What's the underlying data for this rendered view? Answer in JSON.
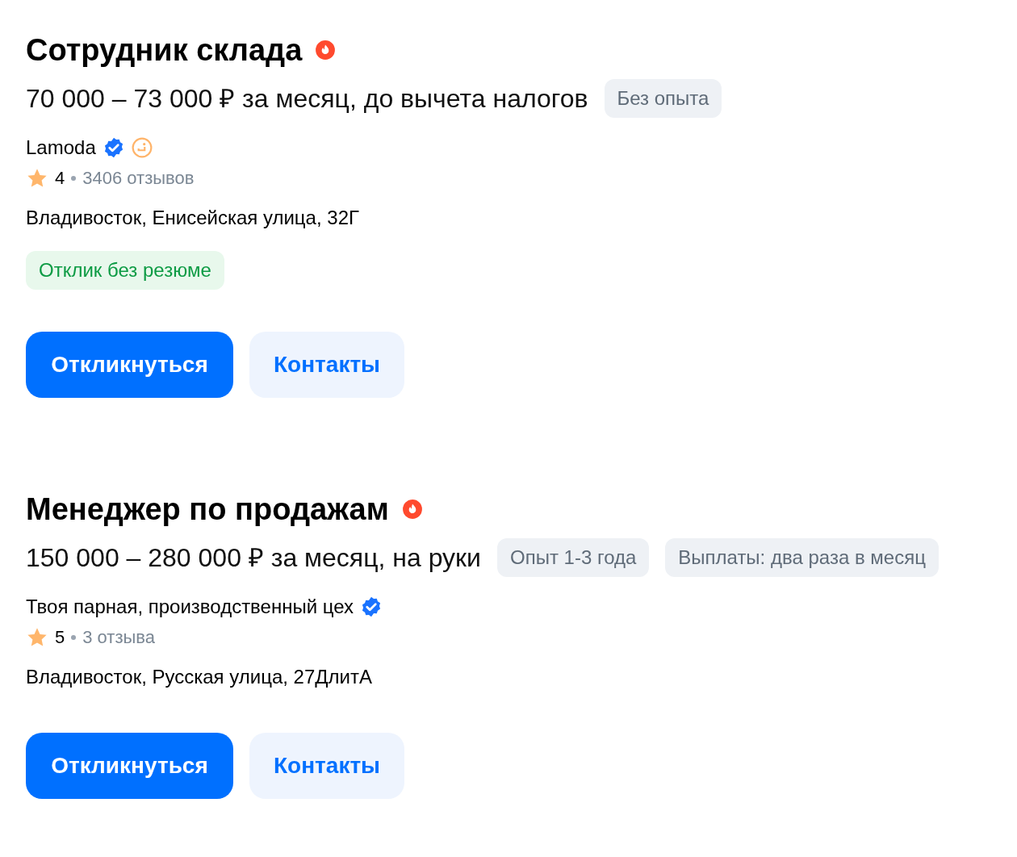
{
  "vacancies": [
    {
      "title": "Сотрудник склада",
      "hot": true,
      "salary": "70 000 – 73 000 ₽ за месяц, до вычета налогов",
      "tags": [
        "Без опыта"
      ],
      "company": "Lamoda",
      "company_badges": [
        {
          "kind": "verified"
        },
        {
          "kind": "accredited"
        }
      ],
      "rating": "4",
      "reviews": "3406 отзывов",
      "address": "Владивосток, Енисейская улица, 32Г",
      "highlight": "Отклик без резюме",
      "buttons": [
        {
          "kind": "primary",
          "label": "Откликнуться"
        },
        {
          "kind": "secondary",
          "label": "Контакты"
        }
      ]
    },
    {
      "title": "Менеджер по продажам",
      "hot": true,
      "salary": "150 000 – 280 000 ₽ за месяц, на руки",
      "tags": [
        "Опыт 1-3 года",
        "Выплаты: два раза в месяц"
      ],
      "company": "Твоя парная, производственный цех",
      "company_badges": [
        {
          "kind": "verified"
        }
      ],
      "rating": "5",
      "reviews": "3 отзыва",
      "address": "Владивосток, Русская улица, 27ДлитА",
      "buttons": [
        {
          "kind": "primary",
          "label": "Откликнуться"
        },
        {
          "kind": "secondary",
          "label": "Контакты"
        }
      ]
    }
  ]
}
